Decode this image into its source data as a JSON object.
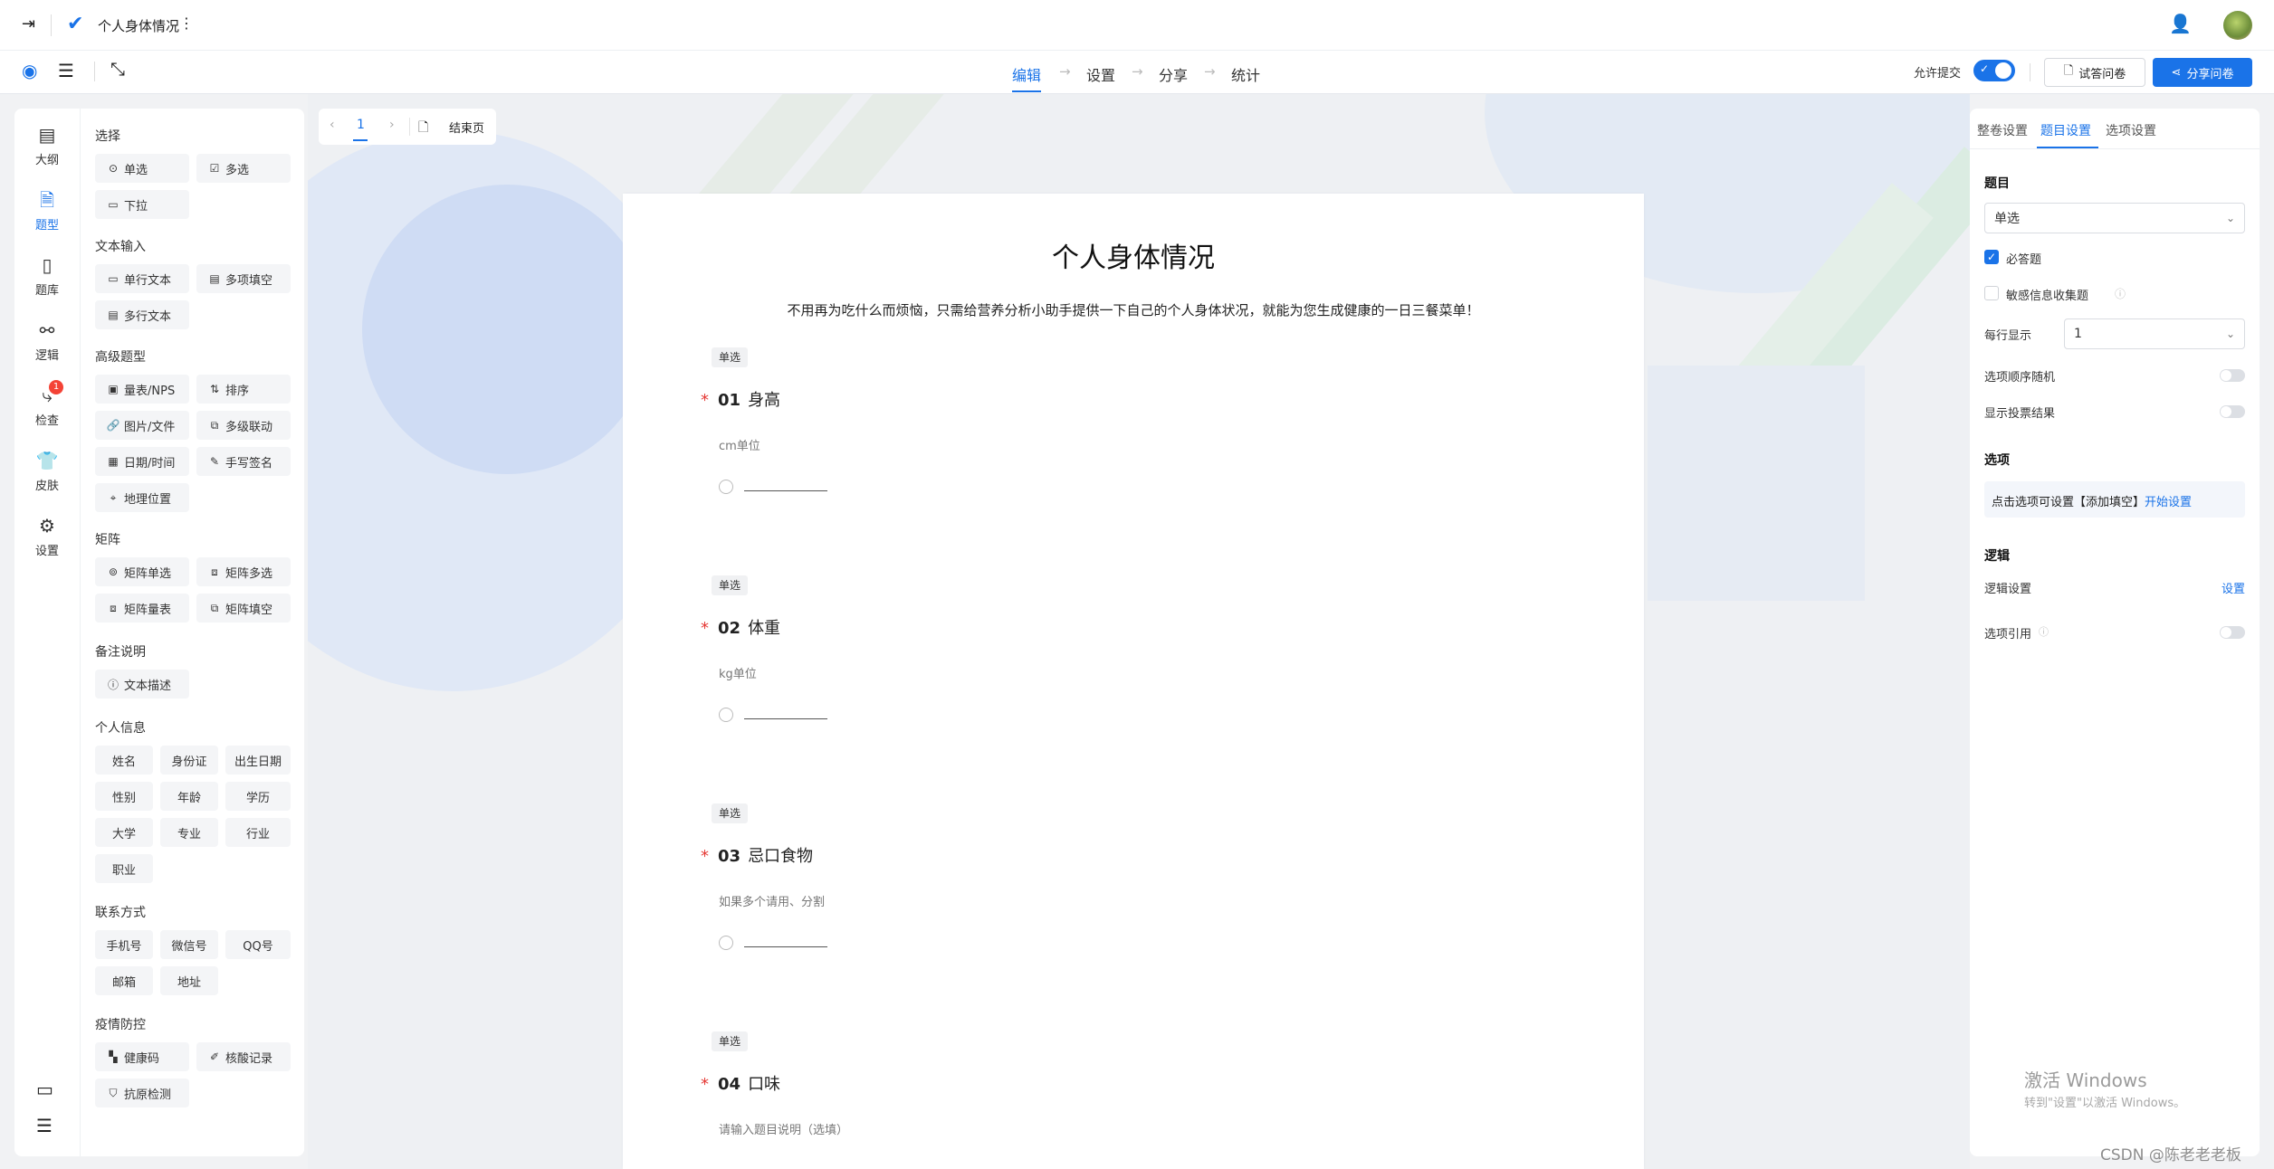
{
  "topbar": {
    "back_icon": "exit-icon",
    "logo_icon": "check-logo-icon",
    "title": "个人身体情况",
    "more_icon": "more-vertical-icon",
    "user_icon": "add-user-icon",
    "avatar_icon": "avatar"
  },
  "toolbar": {
    "preview_icon": "eye-icon",
    "outline_icon": "outline-icon",
    "fullscreen_icon": "collapse-icon",
    "steps": [
      "编辑",
      "设置",
      "分享",
      "统计"
    ],
    "active_step": 0,
    "allow_submit_label": "允许提交",
    "trial_label": "试答问卷",
    "share_label": "分享问卷",
    "accent": "#1a73e8"
  },
  "iconbar": {
    "items": [
      {
        "label": "大纲",
        "icon": "outline-doc-icon"
      },
      {
        "label": "题型",
        "icon": "question-type-icon",
        "active": true
      },
      {
        "label": "题库",
        "icon": "question-bank-icon"
      },
      {
        "label": "逻辑",
        "icon": "logic-icon"
      },
      {
        "label": "检查",
        "icon": "check-flow-icon",
        "badge": "1"
      },
      {
        "label": "皮肤",
        "icon": "shirt-icon"
      },
      {
        "label": "设置",
        "icon": "gear-icon"
      }
    ],
    "bottom_icons": [
      "feedback-icon",
      "collapse-menu-icon"
    ]
  },
  "palette": {
    "sections": [
      {
        "title": "选择",
        "items": [
          {
            "label": "单选",
            "icon": "radio-icon"
          },
          {
            "label": "多选",
            "icon": "checkbox-icon"
          },
          {
            "label": "下拉",
            "icon": "dropdown-icon"
          }
        ]
      },
      {
        "title": "文本输入",
        "items": [
          {
            "label": "单行文本",
            "icon": "single-line-icon"
          },
          {
            "label": "多项填空",
            "icon": "multi-fill-icon"
          },
          {
            "label": "多行文本",
            "icon": "multi-line-icon"
          }
        ]
      },
      {
        "title": "高级题型",
        "items": [
          {
            "label": "量表/NPS",
            "icon": "scale-icon"
          },
          {
            "label": "排序",
            "icon": "sort-icon"
          },
          {
            "label": "图片/文件",
            "icon": "attachment-icon"
          },
          {
            "label": "多级联动",
            "icon": "cascade-icon"
          },
          {
            "label": "日期/时间",
            "icon": "calendar-icon"
          },
          {
            "label": "手写签名",
            "icon": "pen-icon"
          },
          {
            "label": "地理位置",
            "icon": "location-icon"
          }
        ]
      },
      {
        "title": "矩阵",
        "items": [
          {
            "label": "矩阵单选",
            "icon": "matrix-radio-icon"
          },
          {
            "label": "矩阵多选",
            "icon": "matrix-check-icon"
          },
          {
            "label": "矩阵量表",
            "icon": "matrix-scale-icon"
          },
          {
            "label": "矩阵填空",
            "icon": "matrix-fill-icon"
          }
        ]
      },
      {
        "title": "备注说明",
        "items": [
          {
            "label": "文本描述",
            "icon": "info-icon"
          }
        ]
      },
      {
        "title": "个人信息",
        "items": [
          {
            "label": "姓名"
          },
          {
            "label": "身份证"
          },
          {
            "label": "出生日期"
          },
          {
            "label": "性别"
          },
          {
            "label": "年龄"
          },
          {
            "label": "学历"
          },
          {
            "label": "大学"
          },
          {
            "label": "专业"
          },
          {
            "label": "行业"
          },
          {
            "label": "职业"
          }
        ]
      },
      {
        "title": "联系方式",
        "items": [
          {
            "label": "手机号"
          },
          {
            "label": "微信号"
          },
          {
            "label": "QQ号"
          },
          {
            "label": "邮箱"
          },
          {
            "label": "地址"
          }
        ]
      },
      {
        "title": "疫情防控",
        "items": [
          {
            "label": "健康码",
            "icon": "qr-icon"
          },
          {
            "label": "核酸记录",
            "icon": "syringe-icon"
          },
          {
            "label": "抗原检测",
            "icon": "test-icon"
          }
        ]
      }
    ]
  },
  "pagenav": {
    "page": "1",
    "end_label": "结束页"
  },
  "survey": {
    "title": "个人身体情况",
    "description": "不用再为吃什么而烦恼，只需给营养分析小助手提供一下自己的个人身体状况，就能为您生成健康的一日三餐菜单！",
    "questions": [
      {
        "tag": "单选",
        "num": "01",
        "title": "身高",
        "desc": "cm单位"
      },
      {
        "tag": "单选",
        "num": "02",
        "title": "体重",
        "desc": "kg单位"
      },
      {
        "tag": "单选",
        "num": "03",
        "title": "忌口食物",
        "desc": "如果多个请用、分割"
      },
      {
        "tag": "单选",
        "num": "04",
        "title": "口味",
        "desc": "请输入题目说明（选填）"
      }
    ]
  },
  "rpanel": {
    "tabs": [
      "整卷设置",
      "题目设置",
      "选项设置"
    ],
    "active_tab": 1,
    "question_heading": "题目",
    "question_type": "单选",
    "required_label": "必答题",
    "sensitive_label": "敏感信息收集题",
    "per_row_label": "每行显示",
    "per_row_value": "1",
    "random_label": "选项顺序随机",
    "vote_label": "显示投票结果",
    "options_heading": "选项",
    "options_hint": "点击选项可设置【添加填空】",
    "options_link": "开始设置",
    "logic_heading": "逻辑",
    "logic_settings_label": "逻辑设置",
    "logic_settings_link": "设置",
    "option_ref_label": "选项引用"
  },
  "watermark": {
    "line1": "激活 Windows",
    "line2": "转到\"设置\"以激活 Windows。",
    "csdn": "CSDN @陈老老老板"
  }
}
